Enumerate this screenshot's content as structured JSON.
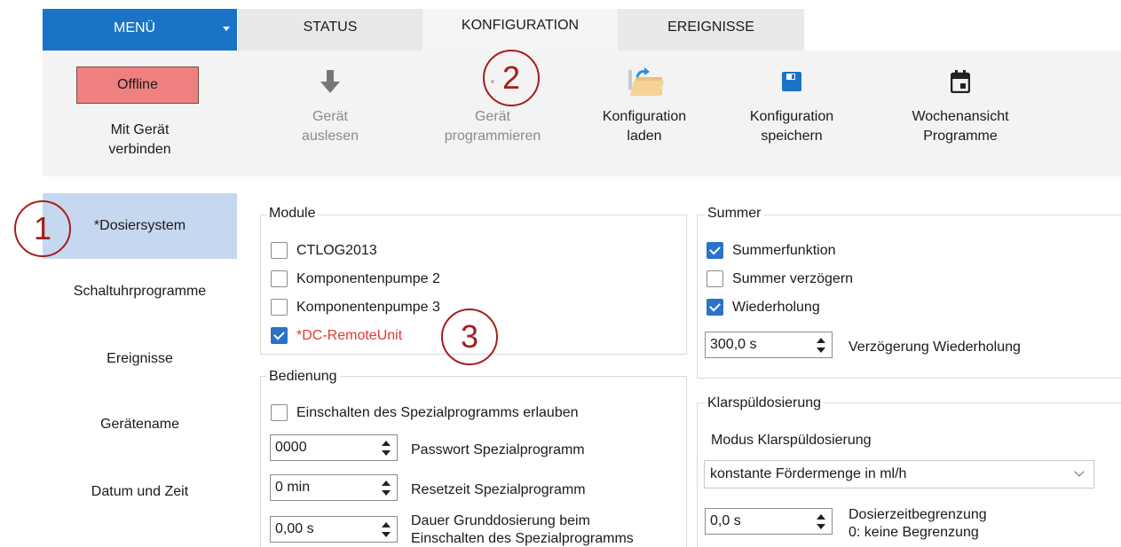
{
  "menu": {
    "label": "MENÜ"
  },
  "tabs": [
    {
      "label": "STATUS"
    },
    {
      "label": "KONFIGURATION"
    },
    {
      "label": "EREIGNISSE"
    }
  ],
  "connection": {
    "offline_label": "Offline",
    "connect_label": "Mit Gerät\nverbinden",
    "offline_color": "#f08080"
  },
  "toolbar": [
    {
      "label": "Gerät\nauslesen",
      "icon": "download-arrow-icon",
      "enabled": false
    },
    {
      "label": "Gerät\nprogrammieren",
      "icon": "upload-arrow-icon",
      "enabled": false
    },
    {
      "label": "Konfiguration\nladen",
      "icon": "folder-open-icon",
      "enabled": true
    },
    {
      "label": "Konfiguration\nspeichern",
      "icon": "save-icon",
      "enabled": true
    },
    {
      "label": "Wochenansicht\nProgramme",
      "icon": "calendar-icon",
      "enabled": true
    }
  ],
  "nav": [
    {
      "label": "*Dosiersystem",
      "active": true
    },
    {
      "label": "Schaltuhrprogramme",
      "active": false
    },
    {
      "label": "Ereignisse",
      "active": false
    },
    {
      "label": "Gerätename",
      "active": false
    },
    {
      "label": "Datum und Zeit",
      "active": false
    }
  ],
  "module": {
    "title": "Module",
    "items": [
      {
        "label": "CTLOG2013",
        "checked": false
      },
      {
        "label": "Komponentenpumpe 2",
        "checked": false
      },
      {
        "label": "Komponentenpumpe 3",
        "checked": false
      },
      {
        "label": "*DC-RemoteUnit",
        "checked": true
      }
    ]
  },
  "summer": {
    "title": "Summer",
    "items": [
      {
        "label": "Summerfunktion",
        "checked": true
      },
      {
        "label": "Summer verzögern",
        "checked": false
      },
      {
        "label": "Wiederholung",
        "checked": true
      }
    ],
    "delay_value": "300,0 s",
    "delay_label": "Verzögerung Wiederholung"
  },
  "bedienung": {
    "title": "Bedienung",
    "allow_label": "Einschalten des Spezialprogramms erlauben",
    "allow_checked": false,
    "password_value": "0000",
    "password_label": "Passwort Spezialprogramm",
    "reset_value": "0 min",
    "reset_label": "Resetzeit Spezialprogramm",
    "base_value": "0,00 s",
    "base_label": "Dauer Grunddosierung beim\nEinschalten des Spezialprogramms"
  },
  "klarspuel": {
    "title": "Klarspüldosierung",
    "mode_label": "Modus Klarspüldosierung",
    "mode_value": "konstante Fördermenge in ml/h",
    "limit_value": "0,0 s",
    "limit_label": "Dosierzeitbegrenzung\n0: keine Begrenzung"
  },
  "annotations": [
    "1",
    "2",
    "3"
  ]
}
